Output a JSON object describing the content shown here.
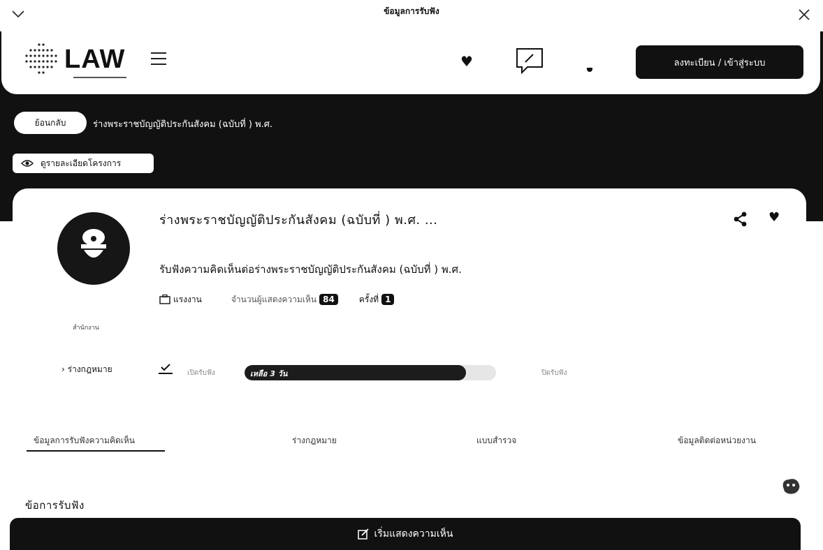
{
  "top_bar": {
    "title": "ข้อมูลการรับฟัง"
  },
  "header": {
    "logo_text": "LAW",
    "login_label": "ลงทะเบียน / เข้าสู่ระบบ"
  },
  "breadcrumb": {
    "back_label": "ย้อนกลับ",
    "current": "ร่างพระราชบัญญัติประกันสังคม (ฉบับที่ ) พ.ศ."
  },
  "detail_button": {
    "label": "ดูรายละเอียดโครงการ"
  },
  "project": {
    "title": "ร่างพระราชบัญญัติประกันสังคม (ฉบับที่  ) พ.ศ. ...",
    "description": "รับฟังความคิดเห็นต่อร่างพระราชบัญญัติประกันสังคม (ฉบับที่  ) พ.ศ.",
    "org_label": "สำนักงาน",
    "meta": {
      "category_label": "แรงงาน",
      "responses_label": "จำนวนผู้แสดงความเห็น",
      "responses_count": "84",
      "round_label": "ครั้งที่",
      "round_value": "1"
    },
    "law_link_label": "ร่างกฎหมาย",
    "status_label": "เปิดรับฟัง",
    "remaining_label": "เหลือ 3 วัน",
    "progress_fraction": 0.88,
    "end_label": "ปิดรับฟัง"
  },
  "tabs": [
    {
      "label": "ข้อมูลการรับฟังความคิดเห็น",
      "active": true
    },
    {
      "label": "ร่างกฎหมาย",
      "active": false
    },
    {
      "label": "แบบสำรวจ",
      "active": false
    },
    {
      "label": "ข้อมูลติดต่อหน่วยงาน",
      "active": false
    }
  ],
  "section": {
    "title": "ข้อการรับฟัง"
  },
  "cta": {
    "label": "เริ่มแสดงความเห็น"
  },
  "colors": {
    "dark": "#111111",
    "background": "#ffffff"
  },
  "icons": [
    "chevron-down-icon",
    "close-icon",
    "heart-icon",
    "chat-pencil-icon",
    "share-icon",
    "check-icon",
    "edit-icon",
    "eye-icon",
    "briefcase-icon"
  ]
}
